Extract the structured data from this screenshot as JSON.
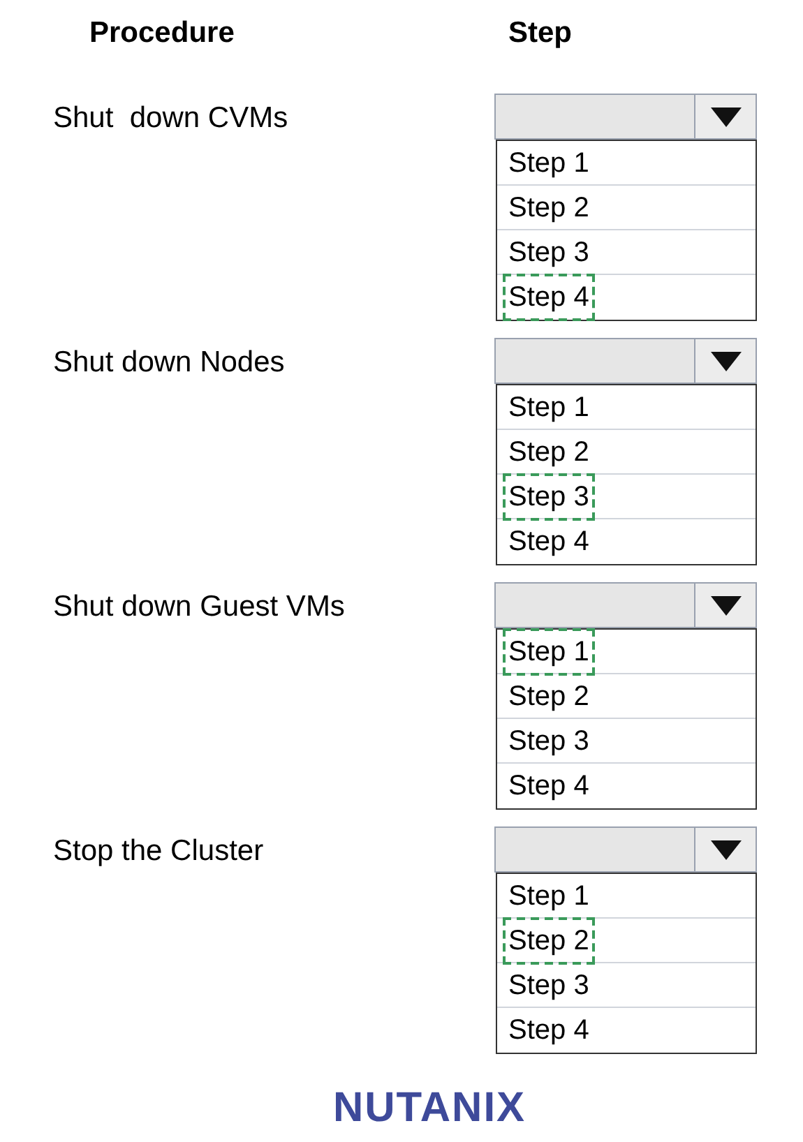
{
  "headers": {
    "procedure": "Procedure",
    "step": "Step"
  },
  "rows": [
    {
      "procedure": "Shut  down CVMs",
      "options": [
        {
          "label": "Step 1",
          "selected": false
        },
        {
          "label": "Step 2",
          "selected": false
        },
        {
          "label": "Step 3",
          "selected": false
        },
        {
          "label": "Step 4",
          "selected": true
        }
      ]
    },
    {
      "procedure": "Shut down Nodes",
      "options": [
        {
          "label": "Step 1",
          "selected": false
        },
        {
          "label": "Step 2",
          "selected": false
        },
        {
          "label": "Step 3",
          "selected": true
        },
        {
          "label": "Step 4",
          "selected": false
        }
      ]
    },
    {
      "procedure": "Shut down Guest VMs",
      "options": [
        {
          "label": "Step 1",
          "selected": true
        },
        {
          "label": "Step 2",
          "selected": false
        },
        {
          "label": "Step 3",
          "selected": false
        },
        {
          "label": "Step 4",
          "selected": false
        }
      ]
    },
    {
      "procedure": "Stop the Cluster",
      "options": [
        {
          "label": "Step 1",
          "selected": false
        },
        {
          "label": "Step 2",
          "selected": true
        },
        {
          "label": "Step 3",
          "selected": false
        },
        {
          "label": "Step 4",
          "selected": false
        }
      ]
    }
  ],
  "logo": "NUTANIX"
}
